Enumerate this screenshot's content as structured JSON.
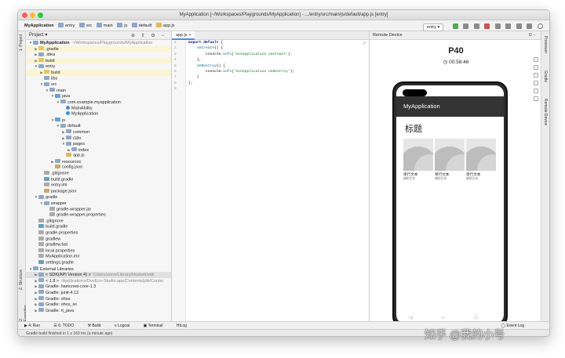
{
  "window": {
    "title": "MyApplication [~/Workspaces/Playgrounds/MyApplication] - .../entry/src/main/js/default/app.js [entry]"
  },
  "navbar": {
    "crumbs": [
      "MyApplication",
      "entry",
      "src",
      "main",
      "js",
      "default",
      "app.js"
    ],
    "run_config": "entry"
  },
  "left_tabs": {
    "project": "1: Project",
    "structure": "Z: Structure",
    "favorites": "2: Favorites"
  },
  "right_tabs": {
    "previewer": "Previewer",
    "gradle": "Gradle",
    "remote": "Remote Device"
  },
  "project_panel": {
    "title": "Project",
    "items": [
      {
        "label": "MyApplication",
        "hint": "~/Workspaces/Playgrounds/MyApplication",
        "depth": 0,
        "arrow": "▼",
        "color": "#8fa7c5",
        "bold": true
      },
      {
        "label": ".gradle",
        "hint": "",
        "depth": 1,
        "arrow": "▶",
        "color": "#e6c45d",
        "hl": true
      },
      {
        "label": ".idea",
        "hint": "",
        "depth": 1,
        "arrow": "▶",
        "color": "#8fa7c5"
      },
      {
        "label": "build",
        "hint": "",
        "depth": 1,
        "arrow": "▶",
        "color": "#e6c45d",
        "hl": true
      },
      {
        "label": "entry",
        "hint": "",
        "depth": 1,
        "arrow": "▼",
        "color": "#8fa7c5"
      },
      {
        "label": "build",
        "hint": "",
        "depth": 2,
        "arrow": "▶",
        "color": "#e6c45d",
        "hl": true
      },
      {
        "label": "libs",
        "hint": "",
        "depth": 2,
        "arrow": "",
        "color": "#8fa7c5"
      },
      {
        "label": "src",
        "hint": "",
        "depth": 2,
        "arrow": "▼",
        "color": "#8fa7c5"
      },
      {
        "label": "main",
        "hint": "",
        "depth": 3,
        "arrow": "▼",
        "color": "#8fa7c5"
      },
      {
        "label": "java",
        "hint": "",
        "depth": 4,
        "arrow": "▼",
        "color": "#6a9fd8"
      },
      {
        "label": "com.example.myapplication",
        "hint": "",
        "depth": 5,
        "arrow": "▼",
        "color": "#8fa7c5"
      },
      {
        "label": "MainAbility",
        "hint": "",
        "depth": 6,
        "arrow": "",
        "color": "#3f8fd2",
        "round": true
      },
      {
        "label": "MyApplication",
        "hint": "",
        "depth": 6,
        "arrow": "",
        "color": "#3f8fd2",
        "round": true
      },
      {
        "label": "js",
        "hint": "",
        "depth": 4,
        "arrow": "▼",
        "color": "#6a9fd8"
      },
      {
        "label": "default",
        "hint": "",
        "depth": 5,
        "arrow": "▼",
        "color": "#8fa7c5"
      },
      {
        "label": "common",
        "hint": "",
        "depth": 6,
        "arrow": "▶",
        "color": "#8fa7c5"
      },
      {
        "label": "i18n",
        "hint": "",
        "depth": 6,
        "arrow": "▶",
        "color": "#8fa7c5"
      },
      {
        "label": "pages",
        "hint": "",
        "depth": 6,
        "arrow": "▼",
        "color": "#8fa7c5"
      },
      {
        "label": "index",
        "hint": "",
        "depth": 7,
        "arrow": "▶",
        "color": "#8fa7c5"
      },
      {
        "label": "app.js",
        "hint": "",
        "depth": 6,
        "arrow": "",
        "color": "#e0b94a"
      },
      {
        "label": "resources",
        "hint": "",
        "depth": 4,
        "arrow": "▶",
        "color": "#8fa7c5"
      },
      {
        "label": "config.json",
        "hint": "",
        "depth": 4,
        "arrow": "",
        "color": "#c9a86a"
      },
      {
        "label": ".gitignore",
        "hint": "",
        "depth": 2,
        "arrow": "",
        "color": "#aaaaaa"
      },
      {
        "label": "build.gradle",
        "hint": "",
        "depth": 2,
        "arrow": "",
        "color": "#6aa0b8"
      },
      {
        "label": "entry.iml",
        "hint": "",
        "depth": 2,
        "arrow": "",
        "color": "#aaaaaa"
      },
      {
        "label": "package.json",
        "hint": "",
        "depth": 2,
        "arrow": "",
        "color": "#c9a86a"
      },
      {
        "label": "gradle",
        "hint": "",
        "depth": 1,
        "arrow": "▼",
        "color": "#8fa7c5"
      },
      {
        "label": "wrapper",
        "hint": "",
        "depth": 2,
        "arrow": "▼",
        "color": "#8fa7c5"
      },
      {
        "label": "gradle-wrapper.jar",
        "hint": "",
        "depth": 3,
        "arrow": "",
        "color": "#aaaaaa"
      },
      {
        "label": "gradle-wrapper.properties",
        "hint": "",
        "depth": 3,
        "arrow": "",
        "color": "#aaaaaa"
      },
      {
        "label": ".gitignore",
        "hint": "",
        "depth": 1,
        "arrow": "",
        "color": "#aaaaaa"
      },
      {
        "label": "build.gradle",
        "hint": "",
        "depth": 1,
        "arrow": "",
        "color": "#6aa0b8"
      },
      {
        "label": "gradle.properties",
        "hint": "",
        "depth": 1,
        "arrow": "",
        "color": "#aaaaaa"
      },
      {
        "label": "gradlew",
        "hint": "",
        "depth": 1,
        "arrow": "",
        "color": "#aaaaaa"
      },
      {
        "label": "gradlew.bat",
        "hint": "",
        "depth": 1,
        "arrow": "",
        "color": "#aaaaaa"
      },
      {
        "label": "local.properties",
        "hint": "",
        "depth": 1,
        "arrow": "",
        "color": "#aaaaaa"
      },
      {
        "label": "MyApplication.iml",
        "hint": "",
        "depth": 1,
        "arrow": "",
        "color": "#aaaaaa"
      },
      {
        "label": "settings.gradle",
        "hint": "",
        "depth": 1,
        "arrow": "",
        "color": "#6aa0b8"
      },
      {
        "label": "External Libraries",
        "hint": "",
        "depth": 0,
        "arrow": "▼",
        "color": "#8fa7c5"
      },
      {
        "label": "< SDK(API Version 4) >",
        "hint": "/Users/zeno/Library/Huawei/sdk",
        "depth": 1,
        "arrow": "▶",
        "color": "#8fa7c5",
        "sel": true
      },
      {
        "label": "< 1.8 >",
        "hint": "/Applications/DevEco-Studio.app/Contents/jdk/Conter",
        "depth": 1,
        "arrow": "▶",
        "color": "#8fa7c5"
      },
      {
        "label": "Gradle: hamcrest-core-1.3",
        "hint": "",
        "depth": 1,
        "arrow": "▶",
        "color": "#8fa7c5"
      },
      {
        "label": "Gradle: junit-4.12",
        "hint": "",
        "depth": 1,
        "arrow": "▶",
        "color": "#8fa7c5"
      },
      {
        "label": "Gradle: ohos",
        "hint": "",
        "depth": 1,
        "arrow": "▶",
        "color": "#8fa7c5"
      },
      {
        "label": "Gradle: ohos_ivi",
        "hint": "",
        "depth": 1,
        "arrow": "▶",
        "color": "#8fa7c5"
      },
      {
        "label": "Gradle: rt_java",
        "hint": "",
        "depth": 1,
        "arrow": "▶",
        "color": "#8fa7c5"
      }
    ]
  },
  "editor": {
    "tab": "app.js",
    "line_numbers": [
      "1",
      "2",
      "3",
      "4",
      "5",
      "6",
      "7",
      "8",
      "9"
    ],
    "lines": [
      [
        {
          "t": "export default ",
          "c": "kw"
        },
        {
          "t": "{",
          "c": ""
        }
      ],
      [
        {
          "t": "    ",
          "c": ""
        },
        {
          "t": "onCreate",
          "c": "fn"
        },
        {
          "t": "() {",
          "c": ""
        }
      ],
      [
        {
          "t": "        console.",
          "c": ""
        },
        {
          "t": "info",
          "c": "fn"
        },
        {
          "t": "(",
          "c": ""
        },
        {
          "t": "'AceApplication onCreate'",
          "c": "str"
        },
        {
          "t": ");",
          "c": ""
        }
      ],
      [
        {
          "t": "    },",
          "c": ""
        }
      ],
      [
        {
          "t": "    ",
          "c": ""
        },
        {
          "t": "onDestroy",
          "c": "fn"
        },
        {
          "t": "() {",
          "c": ""
        }
      ],
      [
        {
          "t": "        console.",
          "c": ""
        },
        {
          "t": "info",
          "c": "fn"
        },
        {
          "t": "(",
          "c": ""
        },
        {
          "t": "'AceApplication onDestroy'",
          "c": "str"
        },
        {
          "t": ");",
          "c": ""
        }
      ],
      [
        {
          "t": "    }",
          "c": ""
        }
      ],
      [
        {
          "t": "};",
          "c": ""
        }
      ],
      [
        {
          "t": "",
          "c": ""
        }
      ]
    ]
  },
  "remote": {
    "title": "Remote Device",
    "device": "P40",
    "timer": "00:58:46",
    "app": {
      "title": "MyApplication",
      "heading": "标题",
      "cards": [
        {
          "line1": "单行文本",
          "line2": "辅助文本"
        },
        {
          "line1": "单行文本",
          "line2": "辅助文本"
        },
        {
          "line1": "单行文本",
          "line2": "辅助文本"
        }
      ],
      "nav": "◁ ○ □"
    }
  },
  "bottom_bar": {
    "run": "4: Run",
    "todo": "6: TODO",
    "build": "Build",
    "logcat": "Logcat",
    "terminal": "Terminal",
    "hilog": "HiLog",
    "event_log": "Event Log"
  },
  "status": {
    "text": "Gradle build finished in 1 s 163 ms (a minute ago)"
  },
  "watermark": "知乎 @我的小号"
}
